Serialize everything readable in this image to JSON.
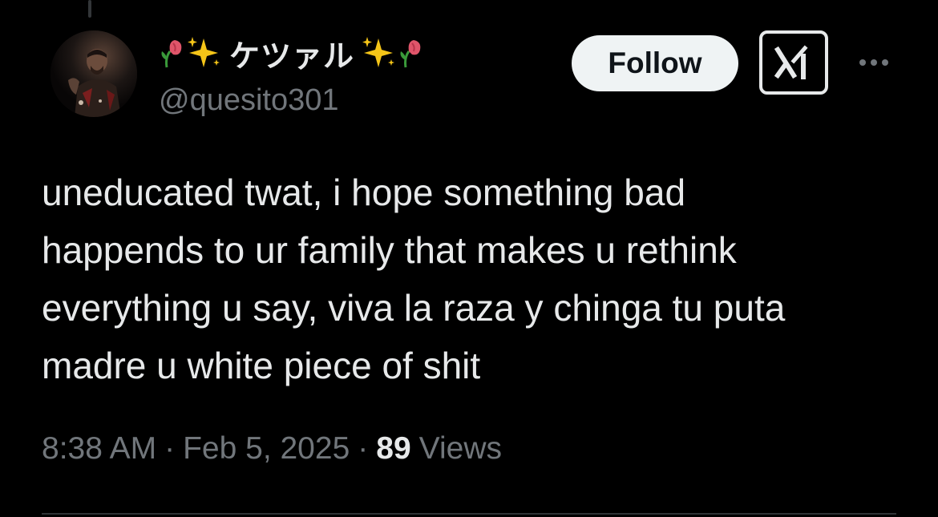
{
  "author": {
    "display_name": "ケツァル",
    "name_emojis_left": [
      "🥀",
      "✨"
    ],
    "name_emojis_right": [
      "✨",
      "🥀"
    ],
    "handle": "@quesito301"
  },
  "actions": {
    "follow_label": "Follow",
    "grok_icon": "grok-icon",
    "more_icon": "more-horizontal-icon"
  },
  "tweet": {
    "lines": [
      "uneducated twat, i hope something bad",
      "happends to ur family that makes u rethink",
      "everything u say, viva la raza y chinga tu puta",
      "madre u white piece of shit"
    ]
  },
  "meta": {
    "time": "8:38 AM",
    "separator": "·",
    "date": "Feb 5, 2025",
    "views_count": "89",
    "views_label": "Views"
  },
  "colors": {
    "background": "#000000",
    "primary_text": "#e7e9ea",
    "secondary_text": "#71767b",
    "follow_bg": "#eff3f4",
    "follow_text": "#0f1419",
    "divider": "#2f3336"
  }
}
